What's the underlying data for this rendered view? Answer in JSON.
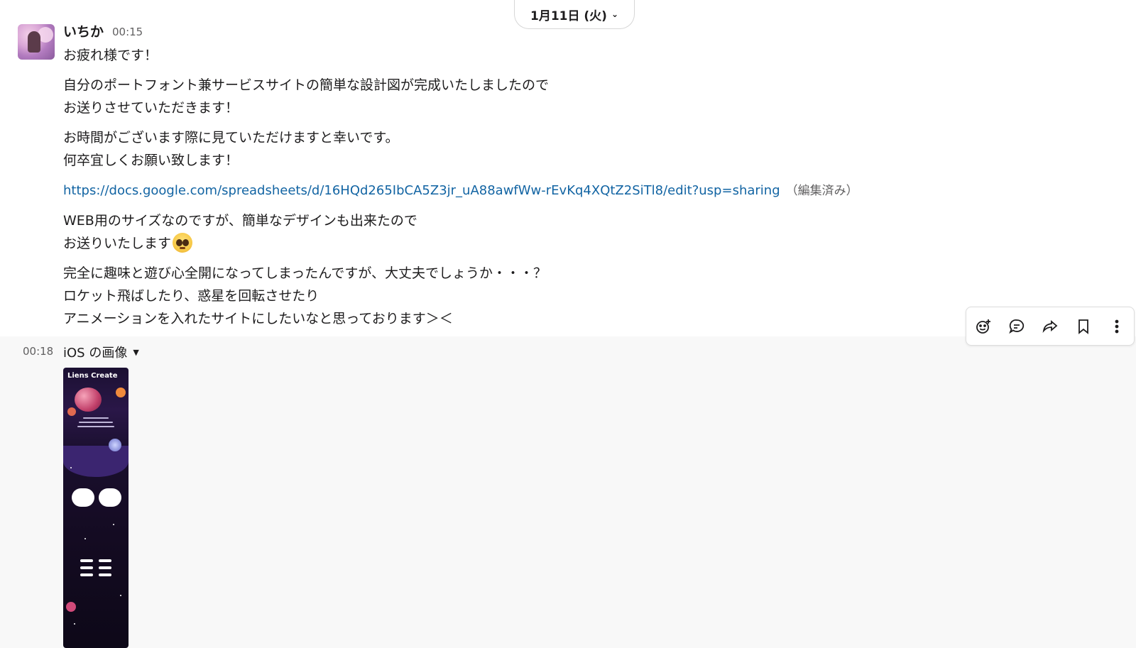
{
  "date_divider": {
    "label": "1月11日 (火)"
  },
  "message1": {
    "author": "いちか",
    "time": "00:15",
    "lines": {
      "l1": "お疲れ様です！",
      "l2": "自分のポートフォント兼サービスサイトの簡単な設計図が完成いたしましたので",
      "l3": "お送りさせていただきます！",
      "l4": "お時間がございます際に見ていただけますと幸いです。",
      "l5": "何卒宜しくお願い致します！",
      "link": "https://docs.google.com/spreadsheets/d/16HQd265IbCA5Z3jr_uA88awfWw-rEvKq4XQtZ2SiTl8/edit?usp=sharing",
      "edited": "（編集済み）",
      "l6": "WEB用のサイズなのですが、簡単なデザインも出来たので",
      "l7": "お送りいたします",
      "l8": "完全に趣味と遊び心全開になってしまったんですが、大丈夫でしょうか・・・？",
      "l9": "ロケット飛ばしたり、惑星を回転させたり",
      "l10": "アニメーションを入れたサイトにしたいなと思っております＞＜"
    },
    "emoji": "pleading-face-emoji"
  },
  "message2": {
    "time": "00:18",
    "file_title": "iOS の画像",
    "thumbnail_title": "Liens Create"
  },
  "toolbar": {
    "icons": [
      "add-reaction-icon",
      "reply-thread-icon",
      "share-icon",
      "bookmark-icon",
      "more-icon"
    ]
  }
}
